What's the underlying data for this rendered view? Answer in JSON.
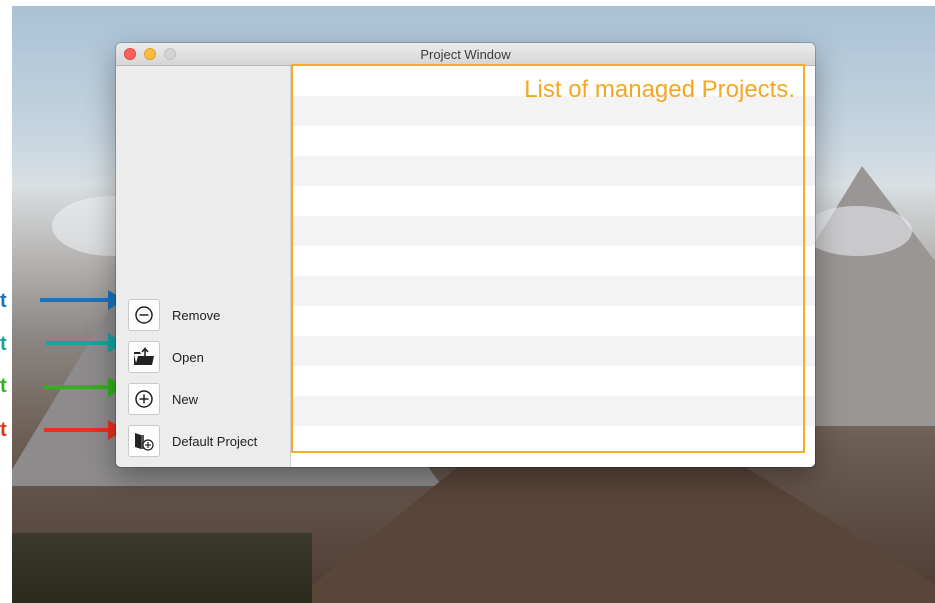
{
  "window": {
    "title": "Project Window"
  },
  "sidebar": {
    "buttons": [
      {
        "label": "Remove",
        "icon": "minus-circle-icon"
      },
      {
        "label": "Open",
        "icon": "open-folder-icon"
      },
      {
        "label": "New",
        "icon": "plus-circle-icon"
      },
      {
        "label": "Default Project",
        "icon": "default-project-icon"
      }
    ]
  },
  "list": {
    "annotation": "List of managed Projects.",
    "row_count": 13
  },
  "annotations": {
    "arrows": [
      {
        "letter": "t",
        "color": "#1a73c0"
      },
      {
        "letter": "t",
        "color": "#19a3a0"
      },
      {
        "letter": "t",
        "color": "#34b01e"
      },
      {
        "letter": "t",
        "color": "#e8321e"
      }
    ],
    "box_color": "#f2ae2c",
    "text_color": "#f5a623"
  }
}
